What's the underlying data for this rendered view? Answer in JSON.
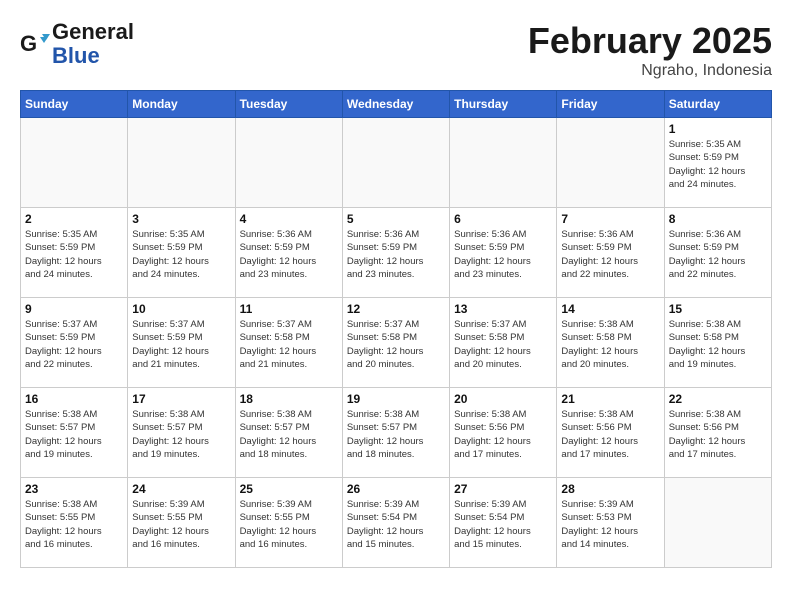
{
  "header": {
    "logo_line1": "General",
    "logo_line2": "Blue",
    "month_title": "February 2025",
    "location": "Ngraho, Indonesia"
  },
  "days_of_week": [
    "Sunday",
    "Monday",
    "Tuesday",
    "Wednesday",
    "Thursday",
    "Friday",
    "Saturday"
  ],
  "weeks": [
    [
      {
        "day": "",
        "info": ""
      },
      {
        "day": "",
        "info": ""
      },
      {
        "day": "",
        "info": ""
      },
      {
        "day": "",
        "info": ""
      },
      {
        "day": "",
        "info": ""
      },
      {
        "day": "",
        "info": ""
      },
      {
        "day": "1",
        "info": "Sunrise: 5:35 AM\nSunset: 5:59 PM\nDaylight: 12 hours\nand 24 minutes."
      }
    ],
    [
      {
        "day": "2",
        "info": "Sunrise: 5:35 AM\nSunset: 5:59 PM\nDaylight: 12 hours\nand 24 minutes."
      },
      {
        "day": "3",
        "info": "Sunrise: 5:35 AM\nSunset: 5:59 PM\nDaylight: 12 hours\nand 24 minutes."
      },
      {
        "day": "4",
        "info": "Sunrise: 5:36 AM\nSunset: 5:59 PM\nDaylight: 12 hours\nand 23 minutes."
      },
      {
        "day": "5",
        "info": "Sunrise: 5:36 AM\nSunset: 5:59 PM\nDaylight: 12 hours\nand 23 minutes."
      },
      {
        "day": "6",
        "info": "Sunrise: 5:36 AM\nSunset: 5:59 PM\nDaylight: 12 hours\nand 23 minutes."
      },
      {
        "day": "7",
        "info": "Sunrise: 5:36 AM\nSunset: 5:59 PM\nDaylight: 12 hours\nand 22 minutes."
      },
      {
        "day": "8",
        "info": "Sunrise: 5:36 AM\nSunset: 5:59 PM\nDaylight: 12 hours\nand 22 minutes."
      }
    ],
    [
      {
        "day": "9",
        "info": "Sunrise: 5:37 AM\nSunset: 5:59 PM\nDaylight: 12 hours\nand 22 minutes."
      },
      {
        "day": "10",
        "info": "Sunrise: 5:37 AM\nSunset: 5:59 PM\nDaylight: 12 hours\nand 21 minutes."
      },
      {
        "day": "11",
        "info": "Sunrise: 5:37 AM\nSunset: 5:58 PM\nDaylight: 12 hours\nand 21 minutes."
      },
      {
        "day": "12",
        "info": "Sunrise: 5:37 AM\nSunset: 5:58 PM\nDaylight: 12 hours\nand 20 minutes."
      },
      {
        "day": "13",
        "info": "Sunrise: 5:37 AM\nSunset: 5:58 PM\nDaylight: 12 hours\nand 20 minutes."
      },
      {
        "day": "14",
        "info": "Sunrise: 5:38 AM\nSunset: 5:58 PM\nDaylight: 12 hours\nand 20 minutes."
      },
      {
        "day": "15",
        "info": "Sunrise: 5:38 AM\nSunset: 5:58 PM\nDaylight: 12 hours\nand 19 minutes."
      }
    ],
    [
      {
        "day": "16",
        "info": "Sunrise: 5:38 AM\nSunset: 5:57 PM\nDaylight: 12 hours\nand 19 minutes."
      },
      {
        "day": "17",
        "info": "Sunrise: 5:38 AM\nSunset: 5:57 PM\nDaylight: 12 hours\nand 19 minutes."
      },
      {
        "day": "18",
        "info": "Sunrise: 5:38 AM\nSunset: 5:57 PM\nDaylight: 12 hours\nand 18 minutes."
      },
      {
        "day": "19",
        "info": "Sunrise: 5:38 AM\nSunset: 5:57 PM\nDaylight: 12 hours\nand 18 minutes."
      },
      {
        "day": "20",
        "info": "Sunrise: 5:38 AM\nSunset: 5:56 PM\nDaylight: 12 hours\nand 17 minutes."
      },
      {
        "day": "21",
        "info": "Sunrise: 5:38 AM\nSunset: 5:56 PM\nDaylight: 12 hours\nand 17 minutes."
      },
      {
        "day": "22",
        "info": "Sunrise: 5:38 AM\nSunset: 5:56 PM\nDaylight: 12 hours\nand 17 minutes."
      }
    ],
    [
      {
        "day": "23",
        "info": "Sunrise: 5:38 AM\nSunset: 5:55 PM\nDaylight: 12 hours\nand 16 minutes."
      },
      {
        "day": "24",
        "info": "Sunrise: 5:39 AM\nSunset: 5:55 PM\nDaylight: 12 hours\nand 16 minutes."
      },
      {
        "day": "25",
        "info": "Sunrise: 5:39 AM\nSunset: 5:55 PM\nDaylight: 12 hours\nand 16 minutes."
      },
      {
        "day": "26",
        "info": "Sunrise: 5:39 AM\nSunset: 5:54 PM\nDaylight: 12 hours\nand 15 minutes."
      },
      {
        "day": "27",
        "info": "Sunrise: 5:39 AM\nSunset: 5:54 PM\nDaylight: 12 hours\nand 15 minutes."
      },
      {
        "day": "28",
        "info": "Sunrise: 5:39 AM\nSunset: 5:53 PM\nDaylight: 12 hours\nand 14 minutes."
      },
      {
        "day": "",
        "info": ""
      }
    ]
  ]
}
